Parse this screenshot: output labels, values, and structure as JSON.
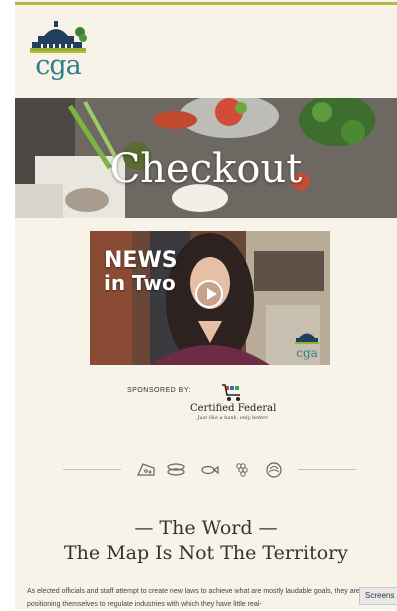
{
  "brand": {
    "logo_text": "cga",
    "accent_color": "#b7b84c",
    "logo_color": "#2e7f86"
  },
  "hero": {
    "title": "Checkout"
  },
  "video": {
    "title_line1": "NEWS",
    "title_line2": "in Two",
    "badge_text": "cga",
    "play_icon": "play-icon"
  },
  "sponsor": {
    "label": "SPONSORED BY:",
    "name": "Certified Federal",
    "tagline": "Just like a bank, only better."
  },
  "divider": {
    "icons": [
      "cheese-icon",
      "bread-icon",
      "fish-icon",
      "grapes-icon",
      "cabbage-icon"
    ]
  },
  "article": {
    "kicker": "— The Word —",
    "title": "The Map Is Not The Territory",
    "body": "As elected officials and staff attempt to create new laws to achieve what are mostly laudable goals, they are often positioning themselves to regulate industries with which they have little real-"
  },
  "overlay": {
    "screens_label": "Screens"
  }
}
